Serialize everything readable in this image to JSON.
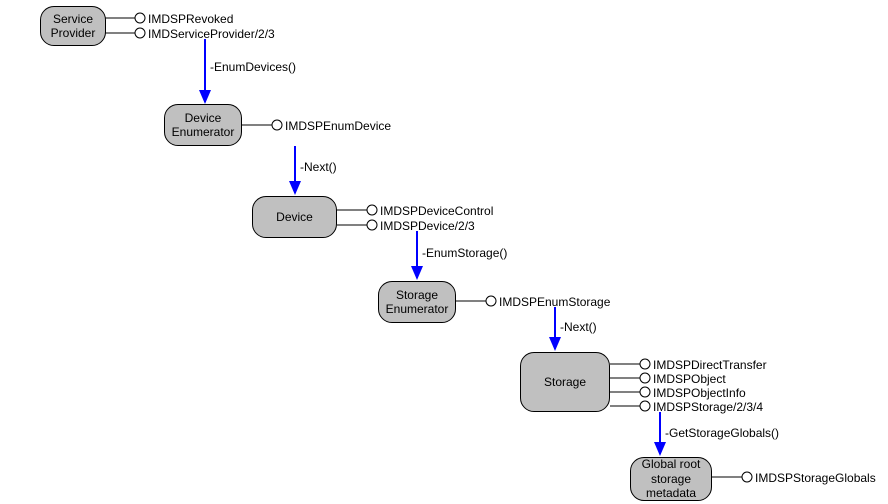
{
  "nodes": {
    "service_provider": "Service\nProvider",
    "device_enumerator": "Device\nEnumerator",
    "device": "Device",
    "storage_enumerator": "Storage\nEnumerator",
    "storage": "Storage",
    "global_root": "Global root\nstorage\nmetadata"
  },
  "interfaces": {
    "imdsp_revoked": "IMDSPRevoked",
    "imd_service_provider": "IMDServiceProvider/2/3",
    "imdsp_enum_device": "IMDSPEnumDevice",
    "imdsp_device_control": "IMDSPDeviceControl",
    "imdsp_device": "IMDSPDevice/2/3",
    "imdsp_enum_storage": "IMDSPEnumStorage",
    "imdsp_direct_transfer": "IMDSPDirectTransfer",
    "imdsp_object": "IMDSPObject",
    "imdsp_object_info": "IMDSPObjectInfo",
    "imdsp_storage": "IMDSPStorage/2/3/4",
    "imdsp_storage_globals": "IMDSPStorageGlobals"
  },
  "methods": {
    "enum_devices": "-EnumDevices()",
    "next1": "-Next()",
    "enum_storage": "-EnumStorage()",
    "next2": "-Next()",
    "get_storage_globals": "-GetStorageGlobals()"
  }
}
